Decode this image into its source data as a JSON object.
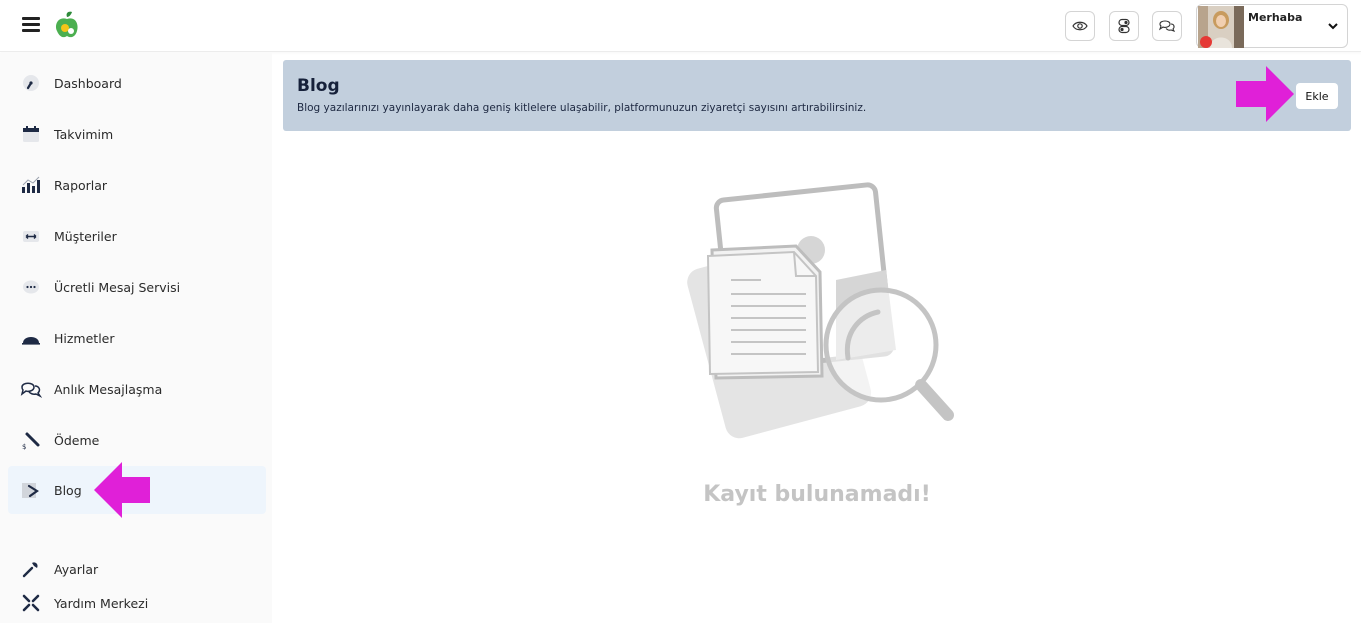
{
  "topbar": {
    "menu_icon": "hamburger-icon",
    "logo_icon": "apple-logo-icon",
    "actions": [
      {
        "name": "preview-button",
        "icon": "eye-icon"
      },
      {
        "name": "toggle-button",
        "icon": "toggle-icon"
      },
      {
        "name": "chat-button",
        "icon": "chat-icon"
      }
    ],
    "user": {
      "greeting": "Merhaba",
      "avatar_icon": "user-avatar",
      "chevron_icon": "chevron-down-icon"
    }
  },
  "sidebar": {
    "items": [
      {
        "label": "Dashboard",
        "icon": "gauge-icon"
      },
      {
        "label": "Takvimim",
        "icon": "calendar-icon"
      },
      {
        "label": "Raporlar",
        "icon": "bar-chart-icon"
      },
      {
        "label": "Müşteriler",
        "icon": "customers-icon"
      },
      {
        "label": "Ücretli Mesaj Servisi",
        "icon": "message-dots-icon"
      },
      {
        "label": "Hizmetler",
        "icon": "cloche-icon"
      },
      {
        "label": "Anlık Mesajlaşma",
        "icon": "chat-icon"
      },
      {
        "label": "Ödeme",
        "icon": "payment-icon"
      },
      {
        "label": "Blog",
        "icon": "pencil-icon",
        "active": true
      }
    ],
    "bottom_items": [
      {
        "label": "Ayarlar",
        "icon": "wrench-icon"
      },
      {
        "label": "Yardım Merkezi",
        "icon": "help-icon"
      }
    ]
  },
  "page": {
    "title": "Blog",
    "description": "Blog yazılarınızı yayınlayarak daha geniş kitlelere ulaşabilir, platformunuzun ziyaretçi sayısını artırabilirsiniz.",
    "add_button_label": "Ekle",
    "empty_message": "Kayıt bulunamadı!"
  },
  "colors": {
    "banner_bg": "#c2cfdd",
    "active_item_bg": "#eef5fc",
    "arrow": "#e020d8",
    "empty_text": "#c4c4c4"
  }
}
